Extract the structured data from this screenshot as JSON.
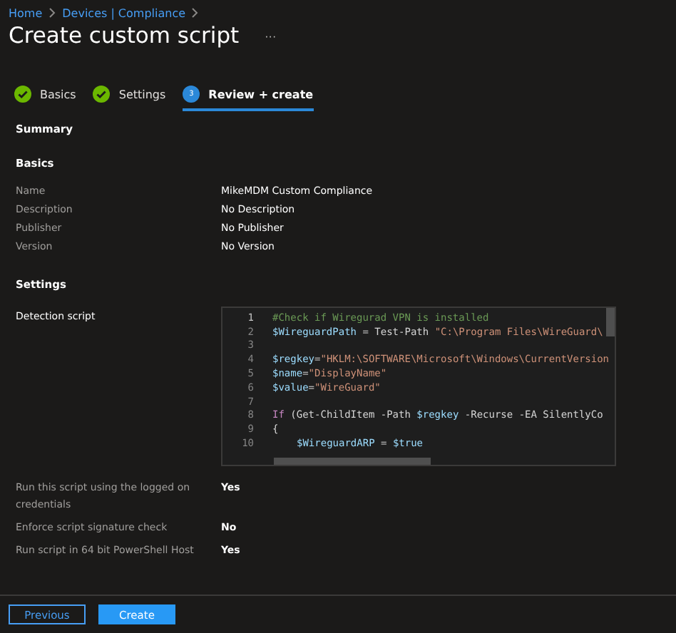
{
  "breadcrumb": [
    {
      "label": "Home"
    },
    {
      "label": "Devices | Compliance"
    }
  ],
  "title": "Create custom script",
  "more": "···",
  "steps": [
    {
      "label": "Basics",
      "kind": "done",
      "selected": false
    },
    {
      "label": "Settings",
      "kind": "done",
      "selected": false
    },
    {
      "label": "Review + create",
      "kind": "current",
      "number": "3",
      "selected": true
    }
  ],
  "summary": "Summary",
  "basics": {
    "heading": "Basics",
    "rows": [
      {
        "label": "Name",
        "value": "MikeMDM Custom Compliance"
      },
      {
        "label": "Description",
        "value": "No Description"
      },
      {
        "label": "Publisher",
        "value": "No Publisher"
      },
      {
        "label": "Version",
        "value": "No Version"
      }
    ]
  },
  "settings": {
    "heading": "Settings",
    "script_label": "Detection script",
    "code": [
      {
        "number": "1",
        "tokens": [
          {
            "kind": "comment",
            "text": "#Check if Wiregurad VPN is installed"
          }
        ]
      },
      {
        "number": "2",
        "tokens": [
          {
            "kind": "var",
            "text": "$WireguardPath"
          },
          {
            "kind": "plain",
            "text": " = Test-Path "
          },
          {
            "kind": "string",
            "text": "\"C:\\Program Files\\WireGuard\\"
          }
        ]
      },
      {
        "number": "3"
      },
      {
        "number": "4",
        "tokens": [
          {
            "kind": "var",
            "text": "$regkey"
          },
          {
            "kind": "plain",
            "text": "="
          },
          {
            "kind": "string",
            "text": "\"HKLM:\\SOFTWARE\\Microsoft\\Windows\\CurrentVersion"
          }
        ]
      },
      {
        "number": "5",
        "tokens": [
          {
            "kind": "var",
            "text": "$name"
          },
          {
            "kind": "plain",
            "text": "="
          },
          {
            "kind": "string",
            "text": "\"DisplayName\""
          }
        ]
      },
      {
        "number": "6",
        "tokens": [
          {
            "kind": "var",
            "text": "$value"
          },
          {
            "kind": "plain",
            "text": "="
          },
          {
            "kind": "string",
            "text": "\"WireGuard\""
          }
        ]
      },
      {
        "number": "7"
      },
      {
        "number": "8",
        "tokens": [
          {
            "kind": "keyword",
            "text": "If"
          },
          {
            "kind": "plain",
            "text": " (Get-ChildItem -Path "
          },
          {
            "kind": "var",
            "text": "$regkey"
          },
          {
            "kind": "plain",
            "text": " -Recurse -EA SilentlyCo"
          }
        ]
      },
      {
        "number": "9",
        "tokens": [
          {
            "kind": "plain",
            "text": "{"
          }
        ]
      },
      {
        "number": "10",
        "indent": true,
        "tokens": [
          {
            "kind": "var",
            "text": "$WireguardARP"
          },
          {
            "kind": "plain",
            "text": " = "
          },
          {
            "kind": "var",
            "text": "$true"
          }
        ]
      }
    ],
    "rows": [
      {
        "label": "Run this script using the logged on credentials",
        "value": "Yes"
      },
      {
        "label": "Enforce script signature check",
        "value": "No"
      },
      {
        "label": "Run script in 64 bit PowerShell Host",
        "value": "Yes"
      }
    ]
  },
  "buttons": [
    {
      "label": "Previous",
      "kind": "secondary"
    },
    {
      "label": "Create",
      "kind": "primary"
    }
  ]
}
